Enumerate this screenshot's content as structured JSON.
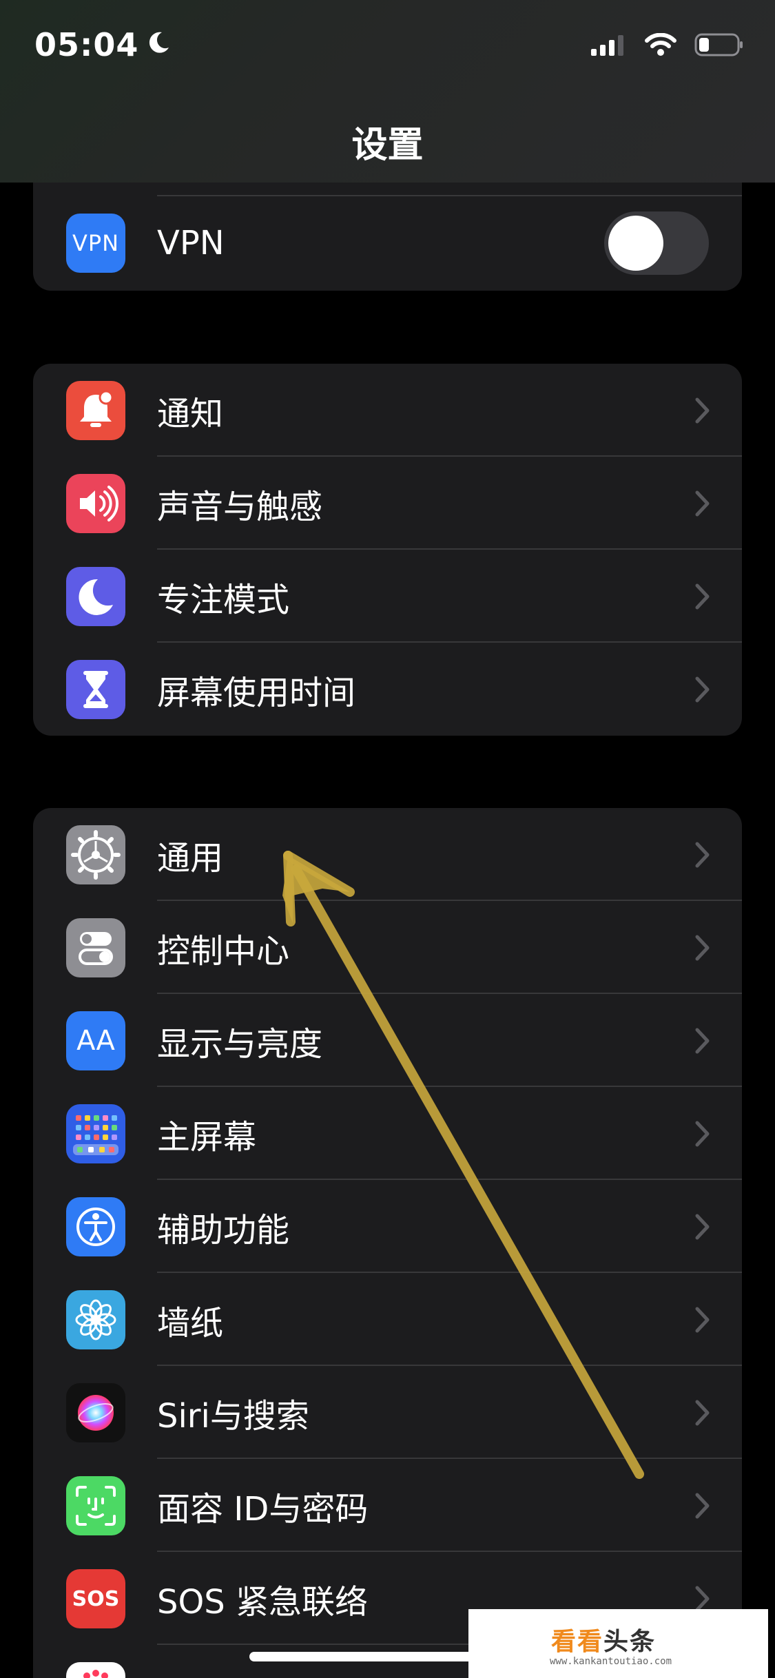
{
  "status_bar": {
    "time": "05:04"
  },
  "nav": {
    "title": "设置"
  },
  "vpn_group": {
    "label": "VPN",
    "icon_text": "VPN",
    "toggle_on": false
  },
  "group2": {
    "items": [
      {
        "label": "通知",
        "icon": "notifications-icon",
        "color": "#eb4d3d"
      },
      {
        "label": "声音与触感",
        "icon": "speaker-icon",
        "color": "#eb445a"
      },
      {
        "label": "专注模式",
        "icon": "moon-icon",
        "color": "#5e5ce6"
      },
      {
        "label": "屏幕使用时间",
        "icon": "hourglass-icon",
        "color": "#5e5ce6"
      }
    ]
  },
  "group3": {
    "items": [
      {
        "label": "通用",
        "icon": "gear-icon",
        "color": "#8e8e93"
      },
      {
        "label": "控制中心",
        "icon": "toggles-icon",
        "color": "#8e8e93"
      },
      {
        "label": "显示与亮度",
        "icon": "text-size-icon",
        "icon_text": "AA",
        "color": "#2f7bf5"
      },
      {
        "label": "主屏幕",
        "icon": "home-screen-icon",
        "color": "#2f5ee6"
      },
      {
        "label": "辅助功能",
        "icon": "accessibility-icon",
        "color": "#2f7bf5"
      },
      {
        "label": "墙纸",
        "icon": "wallpaper-flower-icon",
        "color": "#3aa7e0"
      },
      {
        "label": "Siri与搜索",
        "icon": "siri-icon",
        "color": "#1a1a1a"
      },
      {
        "label": "面容 ID与密码",
        "icon": "face-id-icon",
        "color": "#4cd964"
      },
      {
        "label": "SOS 紧急联络",
        "icon": "sos-icon",
        "icon_text": "SOS",
        "color": "#e53935"
      },
      {
        "label": "",
        "icon": "exposure-icon",
        "color": "#ffffff"
      }
    ]
  },
  "watermark": {
    "text_a": "看看",
    "text_b": "头条",
    "url": "www.kankantoutiao.com"
  },
  "colors": {
    "group_bg": "#1c1c1e",
    "divider": "#38383a",
    "chevron": "#5a5a5e",
    "arrow": "#c9a83c"
  }
}
